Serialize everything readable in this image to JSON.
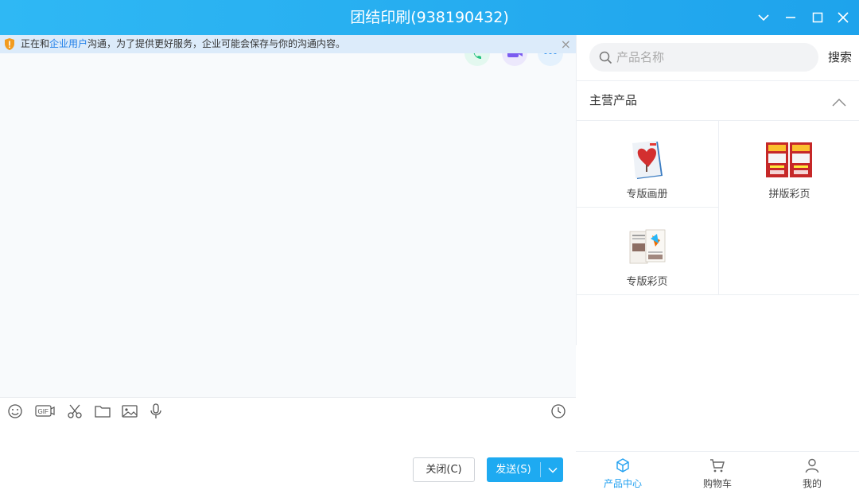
{
  "window": {
    "title": "团结印刷(938190432)"
  },
  "notice": {
    "text_before": "正在和",
    "link": "企业用户",
    "text_after": "沟通，为了提供更好服务，企业可能会保存与你的沟通内容。",
    "close": "×"
  },
  "actions": {
    "close_label": "关闭(C)",
    "send_label": "发送(S)"
  },
  "sidebar": {
    "search_placeholder": "产品名称",
    "search_button": "搜索",
    "section_title": "主营产品",
    "products": [
      {
        "name": "专版画册"
      },
      {
        "name": "拼版彩页"
      },
      {
        "name": "专版彩页"
      }
    ]
  },
  "nav": [
    {
      "label": "产品中心",
      "active": true
    },
    {
      "label": "购物车",
      "active": false
    },
    {
      "label": "我的",
      "active": false
    }
  ],
  "colors": {
    "accent": "#1eaaf1",
    "title_bar": "#26adf0",
    "notice_bg": "#dcebfa",
    "link": "#1e7ee8"
  }
}
